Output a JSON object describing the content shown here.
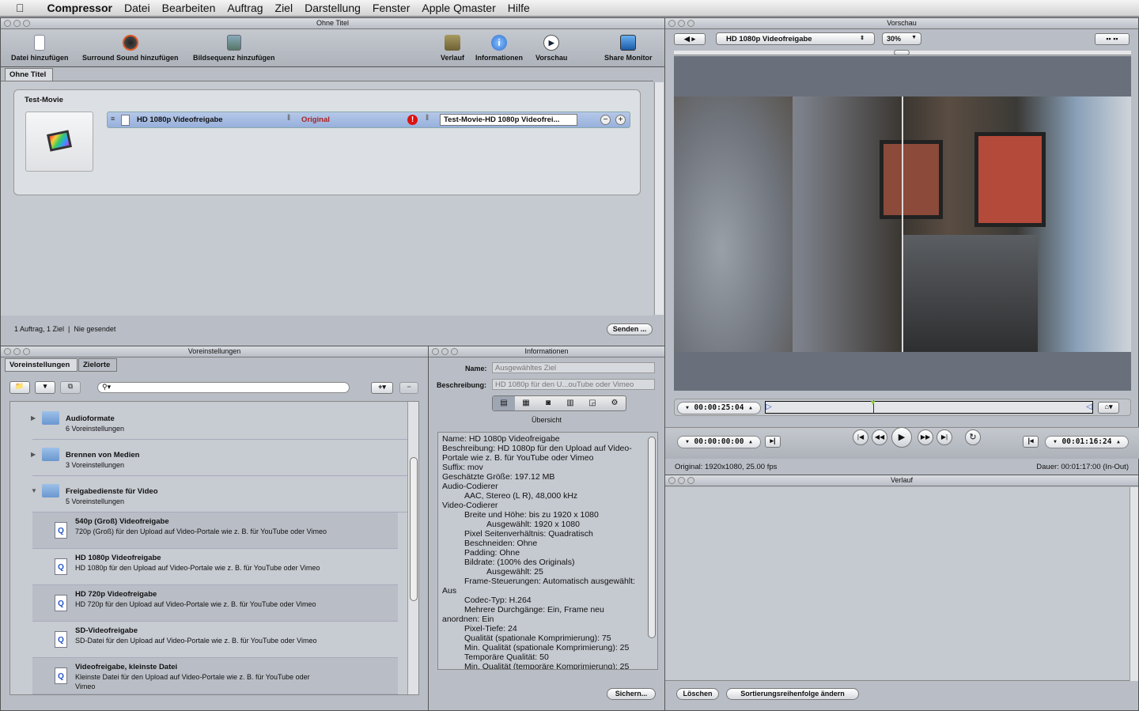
{
  "menubar": {
    "app": "Compressor",
    "items": [
      "Datei",
      "Bearbeiten",
      "Auftrag",
      "Ziel",
      "Darstellung",
      "Fenster",
      "Apple Qmaster",
      "Hilfe"
    ]
  },
  "main_window": {
    "title": "Ohne Titel",
    "toolbar": {
      "add_file": "Datei hinzufügen",
      "add_surround": "Surround Sound hinzufügen",
      "add_sequence": "Bildsequenz hinzufügen",
      "history": "Verlauf",
      "info": "Informationen",
      "preview": "Vorschau",
      "share_monitor": "Share Monitor"
    },
    "tab": "Ohne Titel",
    "job": {
      "name": "Test-Movie",
      "target_setting": "HD 1080p Videofreigabe",
      "destination": "Original",
      "output_name": "Test-Movie-HD 1080p Videofrei..."
    },
    "status": {
      "count": "1 Auftrag, 1 Ziel",
      "sent": "Nie gesendet",
      "send_button": "Senden ..."
    }
  },
  "settings": {
    "title": "Voreinstellungen",
    "tabs": [
      "Voreinstellungen",
      "Zielorte"
    ],
    "search_placeholder": "",
    "groups": [
      {
        "name": "Audioformate",
        "count": "6 Voreinstellungen"
      },
      {
        "name": "Brennen von Medien",
        "count": "3 Voreinstellungen"
      },
      {
        "name": "Freigabedienste für Video",
        "count": "5 Voreinstellungen"
      }
    ],
    "items": [
      {
        "name": "540p (Groß) Videofreigabe",
        "desc": "720p (Groß) für den Upload auf Video-Portale wie z. B. für YouTube oder Vimeo"
      },
      {
        "name": "HD 1080p Videofreigabe",
        "desc": "HD 1080p für den Upload auf Video-Portale wie z. B. für YouTube oder Vimeo"
      },
      {
        "name": "HD 720p Videofreigabe",
        "desc": "HD 720p für den Upload auf Video-Portale wie z. B. für YouTube oder Vimeo"
      },
      {
        "name": "SD-Videofreigabe",
        "desc": "SD-Datei für den Upload auf Video-Portale wie z. B. für YouTube oder Vimeo"
      },
      {
        "name": "Videofreigabe, kleinste Datei",
        "desc": "Kleinste Datei für den Upload auf Video-Portale wie z. B. für YouTube oder Vimeo"
      }
    ]
  },
  "info": {
    "title": "Informationen",
    "name_label": "Name:",
    "name_value": "Ausgewähltes Ziel",
    "desc_label": "Beschreibung:",
    "desc_value": "HD 1080p für den U...ouTube oder Vimeo",
    "section": "Übersicht",
    "save_button": "Sichern...",
    "lines": [
      {
        "t": "Name: HD 1080p Videofreigabe",
        "i": 0
      },
      {
        "t": "Beschreibung: HD 1080p für den Upload auf Video-",
        "i": 0
      },
      {
        "t": "Portale wie z. B. für YouTube oder Vimeo",
        "i": 0
      },
      {
        "t": "Suffix: mov",
        "i": 0
      },
      {
        "t": "Geschätzte Größe: 197.12 MB",
        "i": 0
      },
      {
        "t": "Audio-Codierer",
        "i": 0
      },
      {
        "t": "AAC, Stereo (L R), 48,000 kHz",
        "i": 1
      },
      {
        "t": "Video-Codierer",
        "i": 0
      },
      {
        "t": "Breite und Höhe: bis zu 1920 x 1080",
        "i": 1
      },
      {
        "t": "Ausgewählt: 1920 x 1080",
        "i": 2
      },
      {
        "t": "Pixel Seitenverhältnis: Quadratisch",
        "i": 1
      },
      {
        "t": "Beschneiden: Ohne",
        "i": 1
      },
      {
        "t": "Padding: Ohne",
        "i": 1
      },
      {
        "t": "Bildrate: (100% des Originals)",
        "i": 1
      },
      {
        "t": "Ausgewählt: 25",
        "i": 2
      },
      {
        "t": "Frame-Steuerungen: Automatisch ausgewählt:",
        "i": 1
      },
      {
        "t": "Aus",
        "i": 0
      },
      {
        "t": "Codec-Typ: H.264",
        "i": 1
      },
      {
        "t": "Mehrere Durchgänge: Ein, Frame neu",
        "i": 1
      },
      {
        "t": "anordnen: Ein",
        "i": 0
      },
      {
        "t": "Pixel-Tiefe: 24",
        "i": 1
      },
      {
        "t": "Qualität (spationale Komprimierung): 75",
        "i": 1
      },
      {
        "t": "Min. Qualität (spationale Komprimierung): 25",
        "i": 1
      },
      {
        "t": "Temporäre Qualität: 50",
        "i": 1
      },
      {
        "t": "Min. Qualität (temporäre Komprimierung): 25",
        "i": 1
      }
    ]
  },
  "preview": {
    "title": "Vorschau",
    "setting": "HD 1080p Videofreigabe",
    "zoom": "30%",
    "current_timecode": "00:00:25:04",
    "in_timecode": "00:00:00:00",
    "out_timecode": "00:01:16:24",
    "original": "Original: 1920x1080, 25.00 fps",
    "duration": "Dauer: 00:01:17:00 (In-Out)",
    "playhead_fraction": 0.33
  },
  "history": {
    "title": "Verlauf",
    "delete_button": "Löschen",
    "sort_button": "Sortierungsreihenfolge ändern"
  }
}
